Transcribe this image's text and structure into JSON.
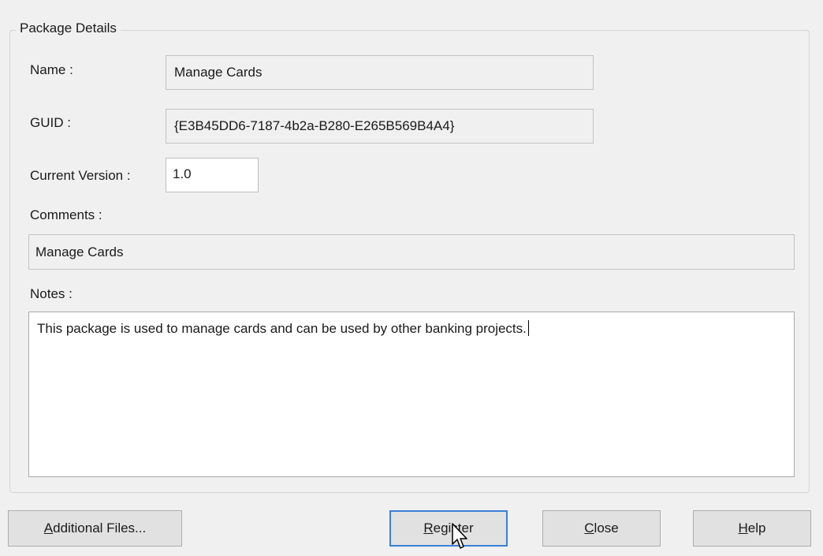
{
  "group": {
    "title": "Package Details"
  },
  "fields": {
    "name": {
      "label": "Name :",
      "value": "Manage Cards"
    },
    "guid": {
      "label": "GUID :",
      "value": "{E3B45DD6-7187-4b2a-B280-E265B569B4A4}"
    },
    "version": {
      "label": "Current Version :",
      "value": "1.0"
    },
    "comments": {
      "label": "Comments :",
      "value": "Manage Cards"
    },
    "notes": {
      "label": "Notes :",
      "value": "This package is used to manage cards and can be used by other banking projects."
    }
  },
  "buttons": {
    "additional_files": {
      "mnemonic": "A",
      "rest": "dditional Files..."
    },
    "register": {
      "mnemonic": "R",
      "rest": "egister"
    },
    "close": {
      "mnemonic": "C",
      "rest": "lose"
    },
    "help": {
      "mnemonic": "H",
      "rest": "elp"
    }
  }
}
